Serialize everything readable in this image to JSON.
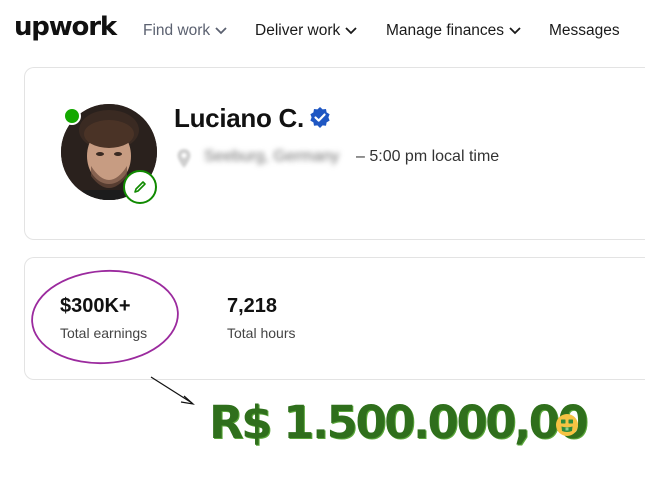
{
  "brand": {
    "logo": "upwork"
  },
  "nav": [
    {
      "label": "Find work",
      "has_menu": true
    },
    {
      "label": "Deliver work",
      "has_menu": true
    },
    {
      "label": "Manage finances",
      "has_menu": true
    },
    {
      "label": "Messages",
      "has_menu": false
    }
  ],
  "profile": {
    "name": "Luciano C.",
    "verified": true,
    "online": true,
    "location": "Seeburg, Germany",
    "local_time": "– 5:00 pm local time"
  },
  "stats": [
    {
      "value": "$300K+",
      "label": "Total earnings"
    },
    {
      "value": "7,218",
      "label": "Total hours"
    }
  ],
  "annotation": {
    "converted_amount": "R$ 1.500.000,00",
    "emoji": "money-mouth-face",
    "highlight_color": "#9b2a9e",
    "amount_color": "#2f6f1c"
  },
  "colors": {
    "brand_green": "#14a800",
    "verified_blue": "#1f57c3"
  }
}
